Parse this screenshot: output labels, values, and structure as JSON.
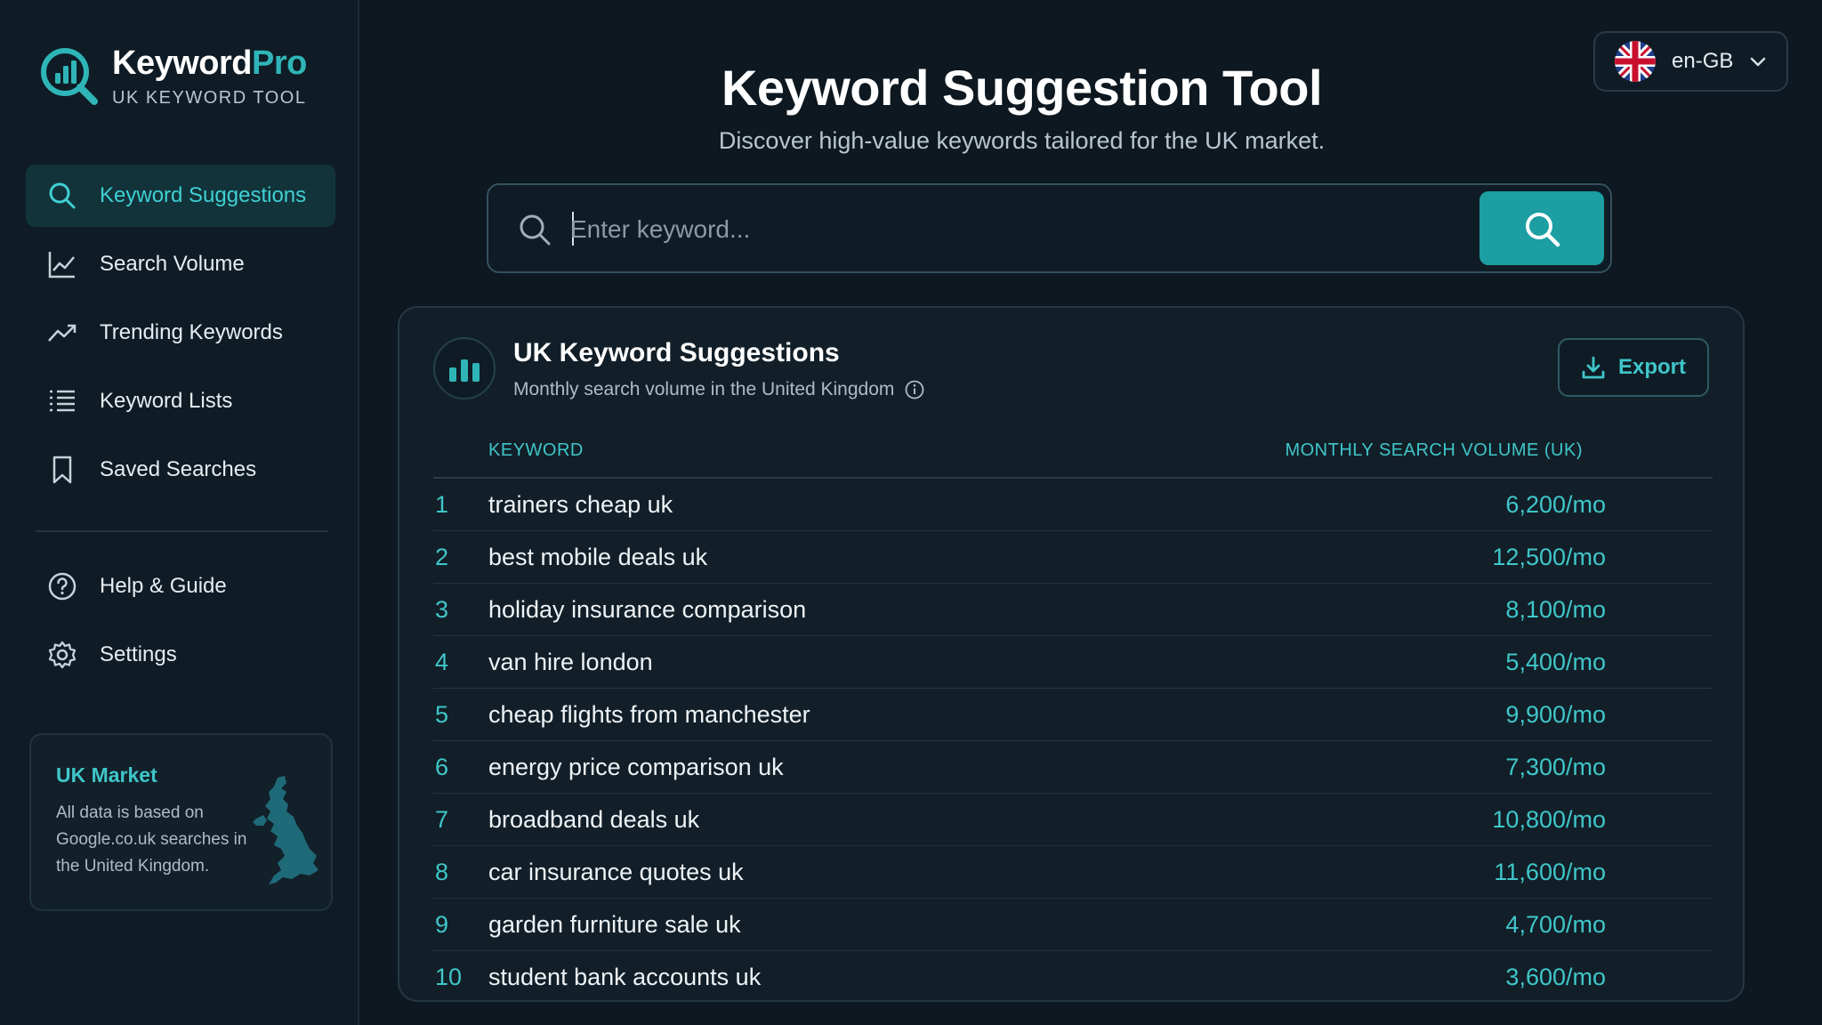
{
  "brand": {
    "name_main": "Keyword",
    "name_accent": "Pro",
    "subtitle": "UK KEYWORD TOOL",
    "accent_color": "#2fb5b8"
  },
  "sidebar": {
    "items": [
      {
        "label": "Keyword Suggestions",
        "icon": "search-icon",
        "active": true
      },
      {
        "label": "Search Volume",
        "icon": "line-chart-icon",
        "active": false
      },
      {
        "label": "Trending Keywords",
        "icon": "trending-up-icon",
        "active": false
      },
      {
        "label": "Keyword Lists",
        "icon": "list-icon",
        "active": false
      },
      {
        "label": "Saved Searches",
        "icon": "bookmark-icon",
        "active": false
      }
    ],
    "secondary_items": [
      {
        "label": "Help & Guide",
        "icon": "help-circle-icon"
      },
      {
        "label": "Settings",
        "icon": "gear-icon"
      }
    ],
    "market_card": {
      "title": "UK Market",
      "text": "All data is based on Google.co.uk searches in the United Kingdom.",
      "icon": "uk-map-icon"
    }
  },
  "language": {
    "value": "en-GB",
    "icon": "uk-flag-icon"
  },
  "header": {
    "title": "Keyword Suggestion Tool",
    "subtitle": "Discover high-value keywords tailored for the UK market."
  },
  "search": {
    "placeholder": "Enter keyword...",
    "value": ""
  },
  "panel": {
    "title": "UK Keyword Suggestions",
    "subtitle": "Monthly search volume in the United Kingdom",
    "export_label": "Export",
    "columns": [
      "KEYWORD",
      "MONTHLY SEARCH VOLUME (UK)"
    ],
    "rows": [
      {
        "rank": "1",
        "keyword": "trainers cheap uk",
        "volume": "6,200/mo"
      },
      {
        "rank": "2",
        "keyword": "best mobile deals uk",
        "volume": "12,500/mo"
      },
      {
        "rank": "3",
        "keyword": "holiday insurance comparison",
        "volume": "8,100/mo"
      },
      {
        "rank": "4",
        "keyword": "van hire london",
        "volume": "5,400/mo"
      },
      {
        "rank": "5",
        "keyword": "cheap flights from manchester",
        "volume": "9,900/mo"
      },
      {
        "rank": "6",
        "keyword": "energy price comparison uk",
        "volume": "7,300/mo"
      },
      {
        "rank": "7",
        "keyword": "broadband deals uk",
        "volume": "10,800/mo"
      },
      {
        "rank": "8",
        "keyword": "car insurance quotes uk",
        "volume": "11,600/mo"
      },
      {
        "rank": "9",
        "keyword": "garden furniture sale uk",
        "volume": "4,700/mo"
      },
      {
        "rank": "10",
        "keyword": "student bank accounts uk",
        "volume": "3,600/mo"
      }
    ]
  }
}
